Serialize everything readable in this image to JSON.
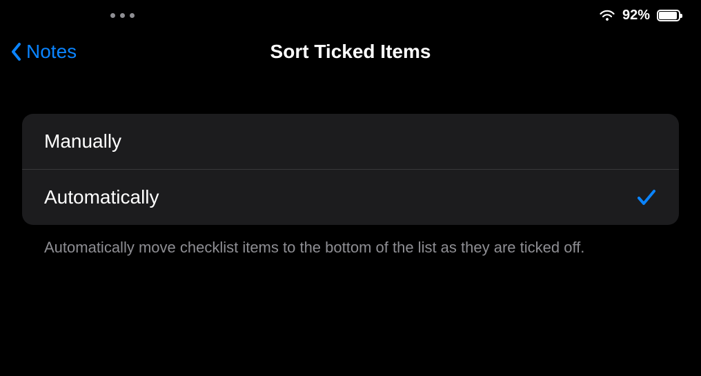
{
  "status": {
    "battery_pct_text": "92%",
    "battery_fill_pct": 92
  },
  "nav": {
    "back_label": "Notes",
    "title": "Sort Ticked Items"
  },
  "options": [
    {
      "label": "Manually",
      "selected": false
    },
    {
      "label": "Automatically",
      "selected": true
    }
  ],
  "footer": "Automatically move checklist items to the bottom of the list as they are ticked off."
}
